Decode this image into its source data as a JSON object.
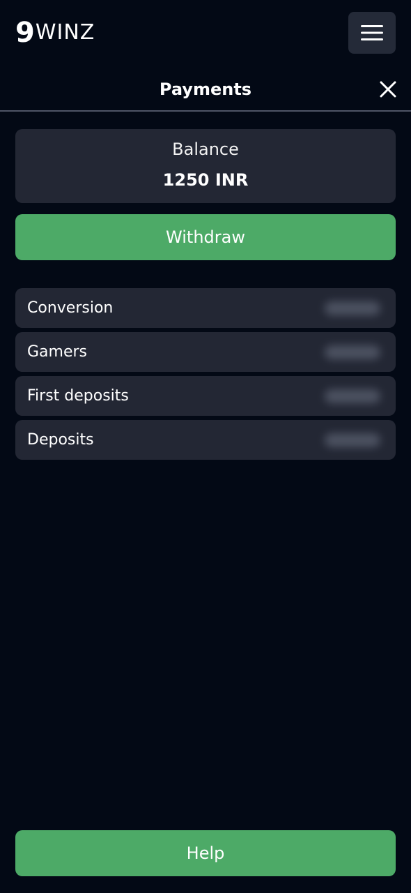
{
  "header": {
    "logo_nine": "9",
    "logo_text": "WINZ",
    "menu_icon": "hamburger-icon"
  },
  "page": {
    "title": "Payments",
    "close_icon": "close-icon"
  },
  "balance": {
    "label": "Balance",
    "value": "1250 INR"
  },
  "actions": {
    "withdraw_label": "Withdraw",
    "help_label": "Help"
  },
  "stats": [
    {
      "label": "Conversion"
    },
    {
      "label": "Gamers"
    },
    {
      "label": "First deposits"
    },
    {
      "label": "Deposits"
    }
  ],
  "colors": {
    "background": "#030915",
    "card": "#232734",
    "accent_green": "#4daa67",
    "menu_button": "#242a38"
  }
}
